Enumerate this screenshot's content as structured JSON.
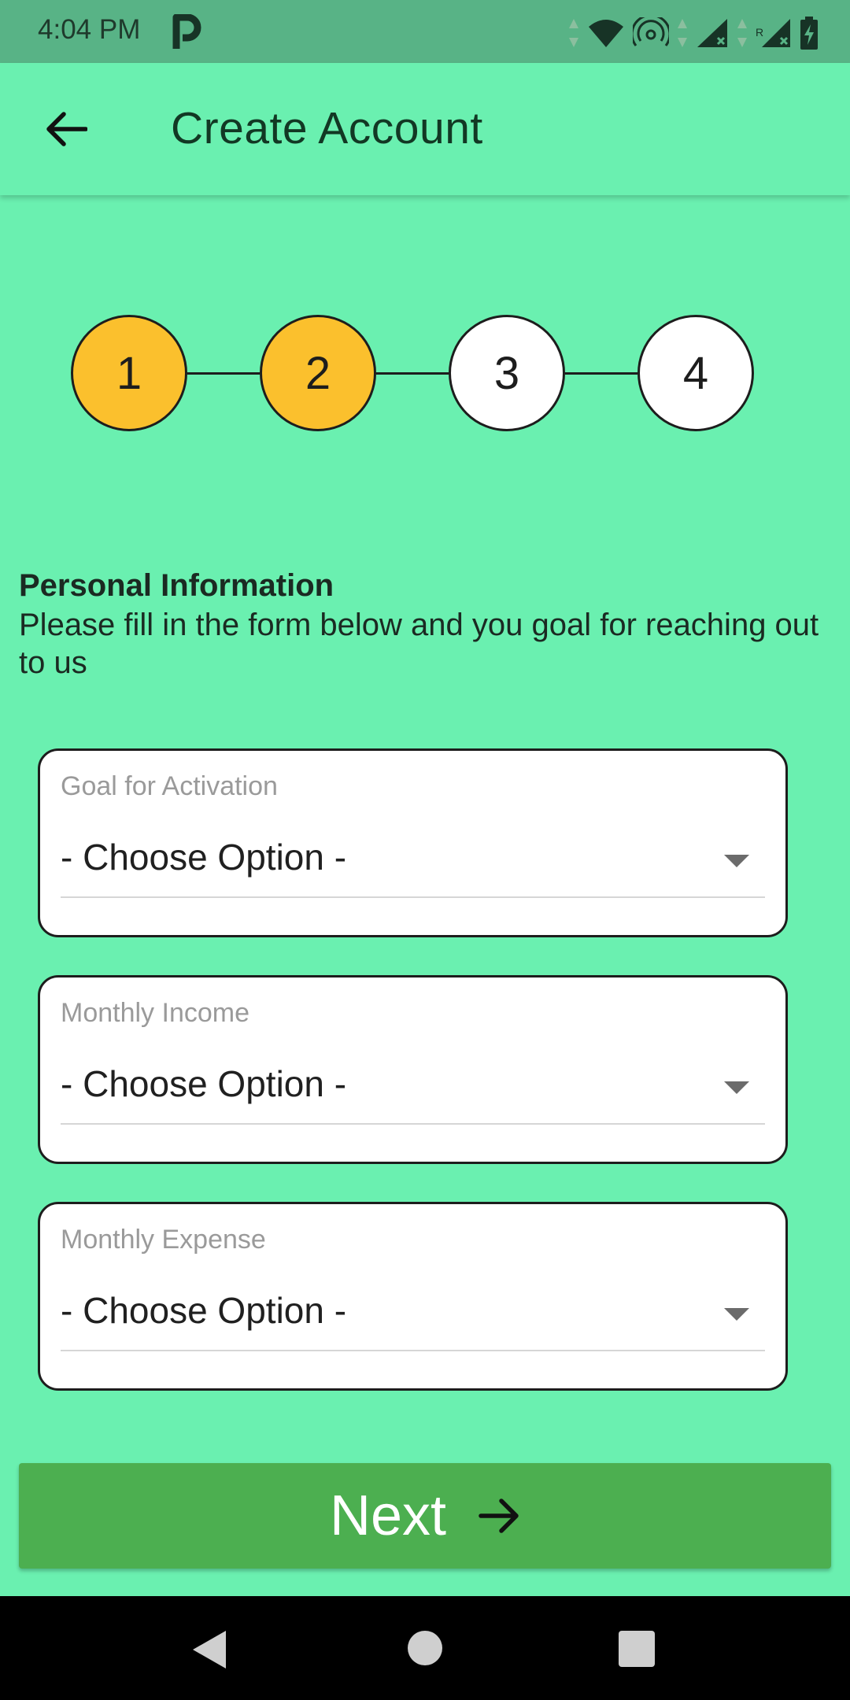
{
  "status_bar": {
    "time": "4:04 PM",
    "icons": [
      "parking-app-icon",
      "data-arrows-icon",
      "wifi-icon",
      "hotspot-icon",
      "signal-icon",
      "roaming-signal-icon",
      "battery-charging-icon"
    ]
  },
  "app_bar": {
    "title": "Create Account",
    "back_icon": "arrow-left-icon"
  },
  "stepper": {
    "steps": [
      {
        "label": "1",
        "state": "active"
      },
      {
        "label": "2",
        "state": "active"
      },
      {
        "label": "3",
        "state": "inactive"
      },
      {
        "label": "4",
        "state": "inactive"
      }
    ],
    "active_color": "#fbc02d",
    "inactive_color": "#ffffff"
  },
  "section": {
    "title": "Personal Information",
    "description": "Please fill in the form below and you goal for reaching out to us"
  },
  "form": {
    "fields": [
      {
        "label": "Goal for Activation",
        "value": "- Choose Option -"
      },
      {
        "label": "Monthly Income",
        "value": "- Choose Option -"
      },
      {
        "label": "Monthly Expense",
        "value": "- Choose Option -"
      }
    ]
  },
  "next_button": {
    "label": "Next",
    "icon": "arrow-right-icon",
    "color": "#4caf50"
  },
  "colors": {
    "background": "#6af0b0",
    "status_bar": "#58b386"
  }
}
